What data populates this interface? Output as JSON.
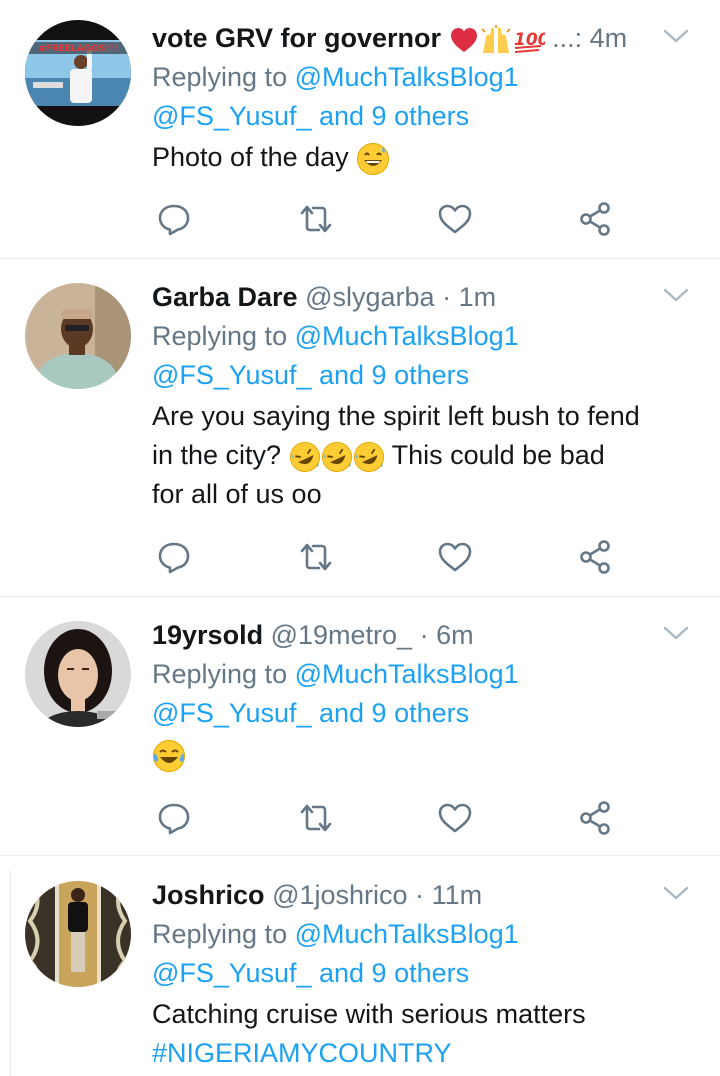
{
  "tweets": [
    {
      "name": "vote GRV for governor",
      "name_emoji": [
        "red-heart",
        "raising-hands",
        "hundred-points"
      ],
      "handle": "...:",
      "dot": "",
      "time": "4m",
      "reply_prefix": "Replying to",
      "reply_to": "@MuchTalksBlog1",
      "reply_others": "@FS_Yusuf_ and 9 others",
      "text": "Photo of the day",
      "text_emoji": [
        "grinning-sweat"
      ],
      "avatar_text": "#FREELAGOS!!!"
    },
    {
      "name": "Garba Dare",
      "handle": "@slygarba",
      "dot": "·",
      "time": "1m",
      "reply_prefix": "Replying to",
      "reply_to": "@MuchTalksBlog1",
      "reply_others": "@FS_Yusuf_ and 9 others",
      "text_line1": "Are you saying the spirit left bush to fend",
      "text_line2a": "in the city?",
      "text_line2b": "This could be bad",
      "text_line3": "for all of us oo",
      "text_emoji": [
        "rolling-laughing",
        "rolling-laughing",
        "rolling-laughing"
      ]
    },
    {
      "name": "19yrsold",
      "handle": "@19metro_",
      "dot": "·",
      "time": "6m",
      "reply_prefix": "Replying to",
      "reply_to": "@MuchTalksBlog1",
      "reply_others": "@FS_Yusuf_ and 9 others",
      "text_emoji": [
        "tears-of-joy"
      ]
    },
    {
      "name": "Joshrico",
      "handle": "@1joshrico",
      "dot": "·",
      "time": "11m",
      "reply_prefix": "Replying to",
      "reply_to": "@MuchTalksBlog1",
      "reply_others": "@FS_Yusuf_ and 9 others",
      "text": "Catching cruise with serious matters",
      "hashtag": "#NIGERIAMYCOUNTRY"
    }
  ],
  "icons": {
    "reply": "reply-icon",
    "retweet": "retweet-icon",
    "like": "like-icon",
    "share": "share-icon",
    "more": "chevron-down-icon"
  },
  "colors": {
    "link": "#1da1f2",
    "text": "#14171a",
    "muted": "#657786",
    "divider": "#e6ecf0"
  }
}
